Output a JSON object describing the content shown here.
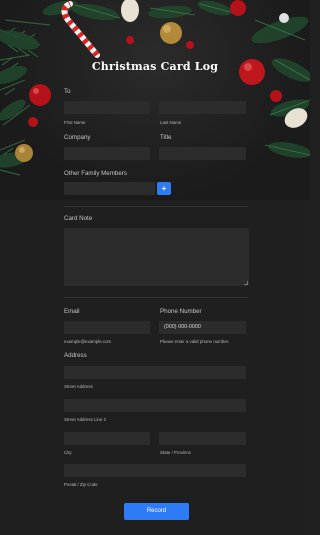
{
  "title": "Christmas Card Log",
  "name": {
    "label": "To",
    "first_sub": "First Name",
    "last_sub": "Last Name"
  },
  "company": {
    "label": "Company"
  },
  "title_field": {
    "label": "Title"
  },
  "family": {
    "label": "Other Family Members",
    "add": "+"
  },
  "note": {
    "label": "Card Note"
  },
  "email": {
    "label": "Email",
    "hint": "example@example.com"
  },
  "phone": {
    "label": "Phone Number",
    "value": "(000) 000-0000",
    "hint": "Please enter a valid phone number."
  },
  "address": {
    "label": "Address",
    "street": "Street Address",
    "street2": "Street Address Line 2",
    "city": "City",
    "state": "State / Province",
    "zip": "Postal / Zip Code"
  },
  "submit": "Record",
  "colors": {
    "accent": "#2d7cf6",
    "background": "#1f1f1f",
    "field": "#2c2c2c"
  },
  "decorations": [
    "pine-branches",
    "candy-cane",
    "red-ornament",
    "gold-ornament",
    "white-ornament"
  ]
}
